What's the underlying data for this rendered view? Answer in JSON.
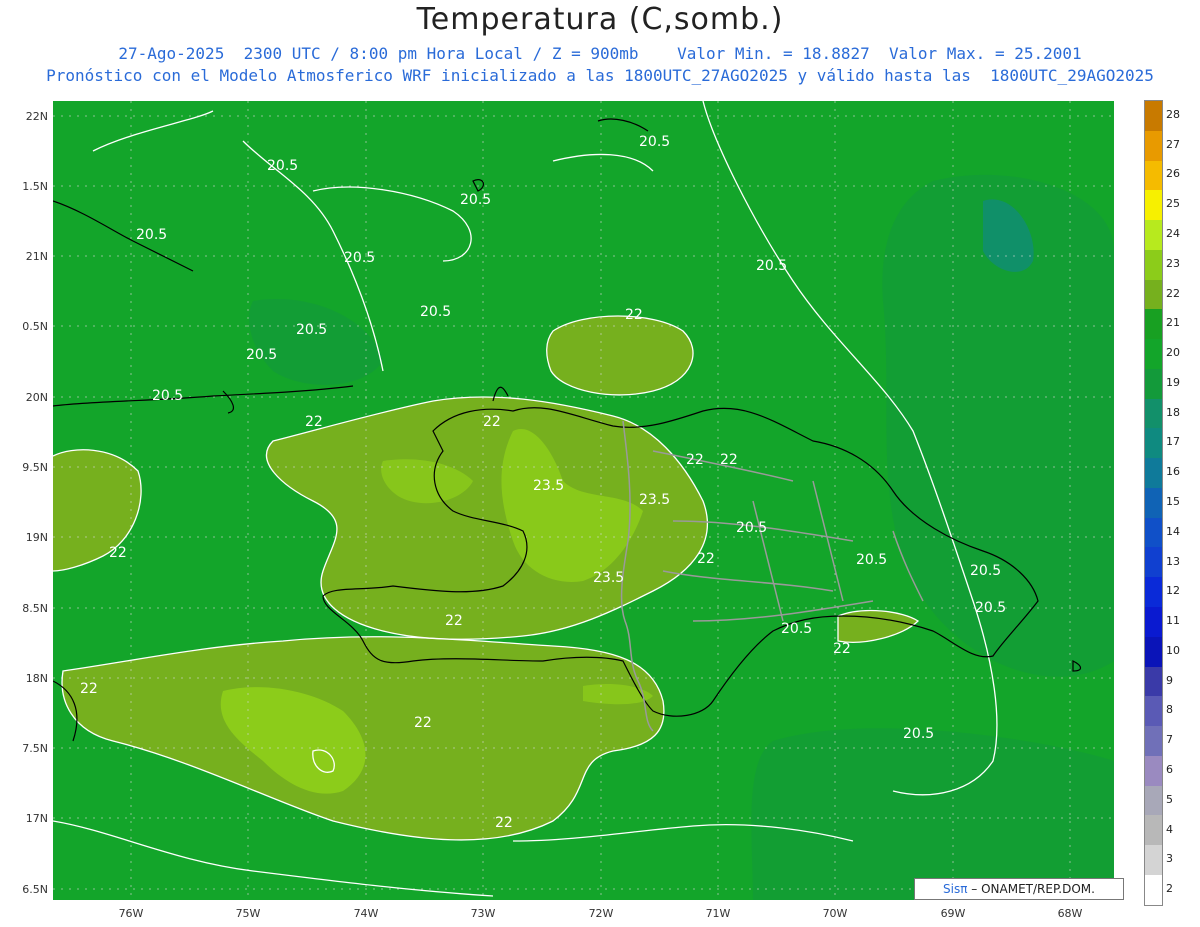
{
  "title": "Temperatura (C,somb.)",
  "subtitle_line1": "27-Ago-2025  2300 UTC / 8:00 pm Hora Local / Z = 900mb    Valor Min. = 18.8827  Valor Max. = 25.2001",
  "subtitle_line2": "Pronóstico con el Modelo Atmosferico WRF inicializado a las 1800UTC_27AGO2025 y válido hasta las  1800UTC_29AGO2025",
  "lat_labels": [
    "22N",
    "1.5N",
    "21N",
    "0.5N",
    "20N",
    "9.5N",
    "19N",
    "8.5N",
    "18N",
    "7.5N",
    "17N",
    "6.5N"
  ],
  "lon_labels": [
    "76W",
    "75W",
    "74W",
    "73W",
    "72W",
    "71W",
    "70W",
    "69W",
    "68W"
  ],
  "legend": {
    "labels": [
      "28",
      "27",
      "26",
      "25",
      "24",
      "23",
      "22",
      "21",
      "20",
      "19",
      "18",
      "17",
      "16",
      "15",
      "14",
      "13",
      "12",
      "11",
      "10",
      "9",
      "8",
      "7",
      "6",
      "5",
      "4",
      "3",
      "2"
    ],
    "colors": [
      "#c87a00",
      "#e89a00",
      "#f5bb00",
      "#f7f000",
      "#b7ea1e",
      "#8ccc1a",
      "#76b01e",
      "#18a022",
      "#13a52a",
      "#139a3a",
      "#12906a",
      "#0f8a80",
      "#0f7a9a",
      "#1063b5",
      "#1050c8",
      "#1040d0",
      "#0a2ad8",
      "#0a1ad0",
      "#0a14b8",
      "#3a3aa8",
      "#5a5ab5",
      "#7070b8",
      "#9a8ac0",
      "#a8a8b8",
      "#b8b8b8",
      "#d4d4d4",
      "#ffffff"
    ]
  },
  "credit": {
    "brand": "Sisπ",
    "text": " – ONAMET/REP.DOM."
  },
  "contour_labels": [
    "20.5",
    "20.5",
    "20.5",
    "20.5",
    "20.5",
    "20.5",
    "20.5",
    "20.5",
    "22",
    "22",
    "22",
    "22",
    "22",
    "22",
    "22",
    "22",
    "22",
    "23.5",
    "23.5",
    "23.5",
    "20.5",
    "20.5",
    "20.5",
    "20.5",
    "20.5",
    "20.5",
    "20.5",
    "20.5",
    "22",
    "22",
    "22"
  ],
  "colors": {
    "base_field": "#13a52a",
    "warm_field": "#76b01e",
    "hot_field": "#8ccc1a",
    "cool_field": "#139a3a",
    "contour": "#ffffff",
    "coast": "#000000",
    "borders": "#9a9a9a"
  }
}
